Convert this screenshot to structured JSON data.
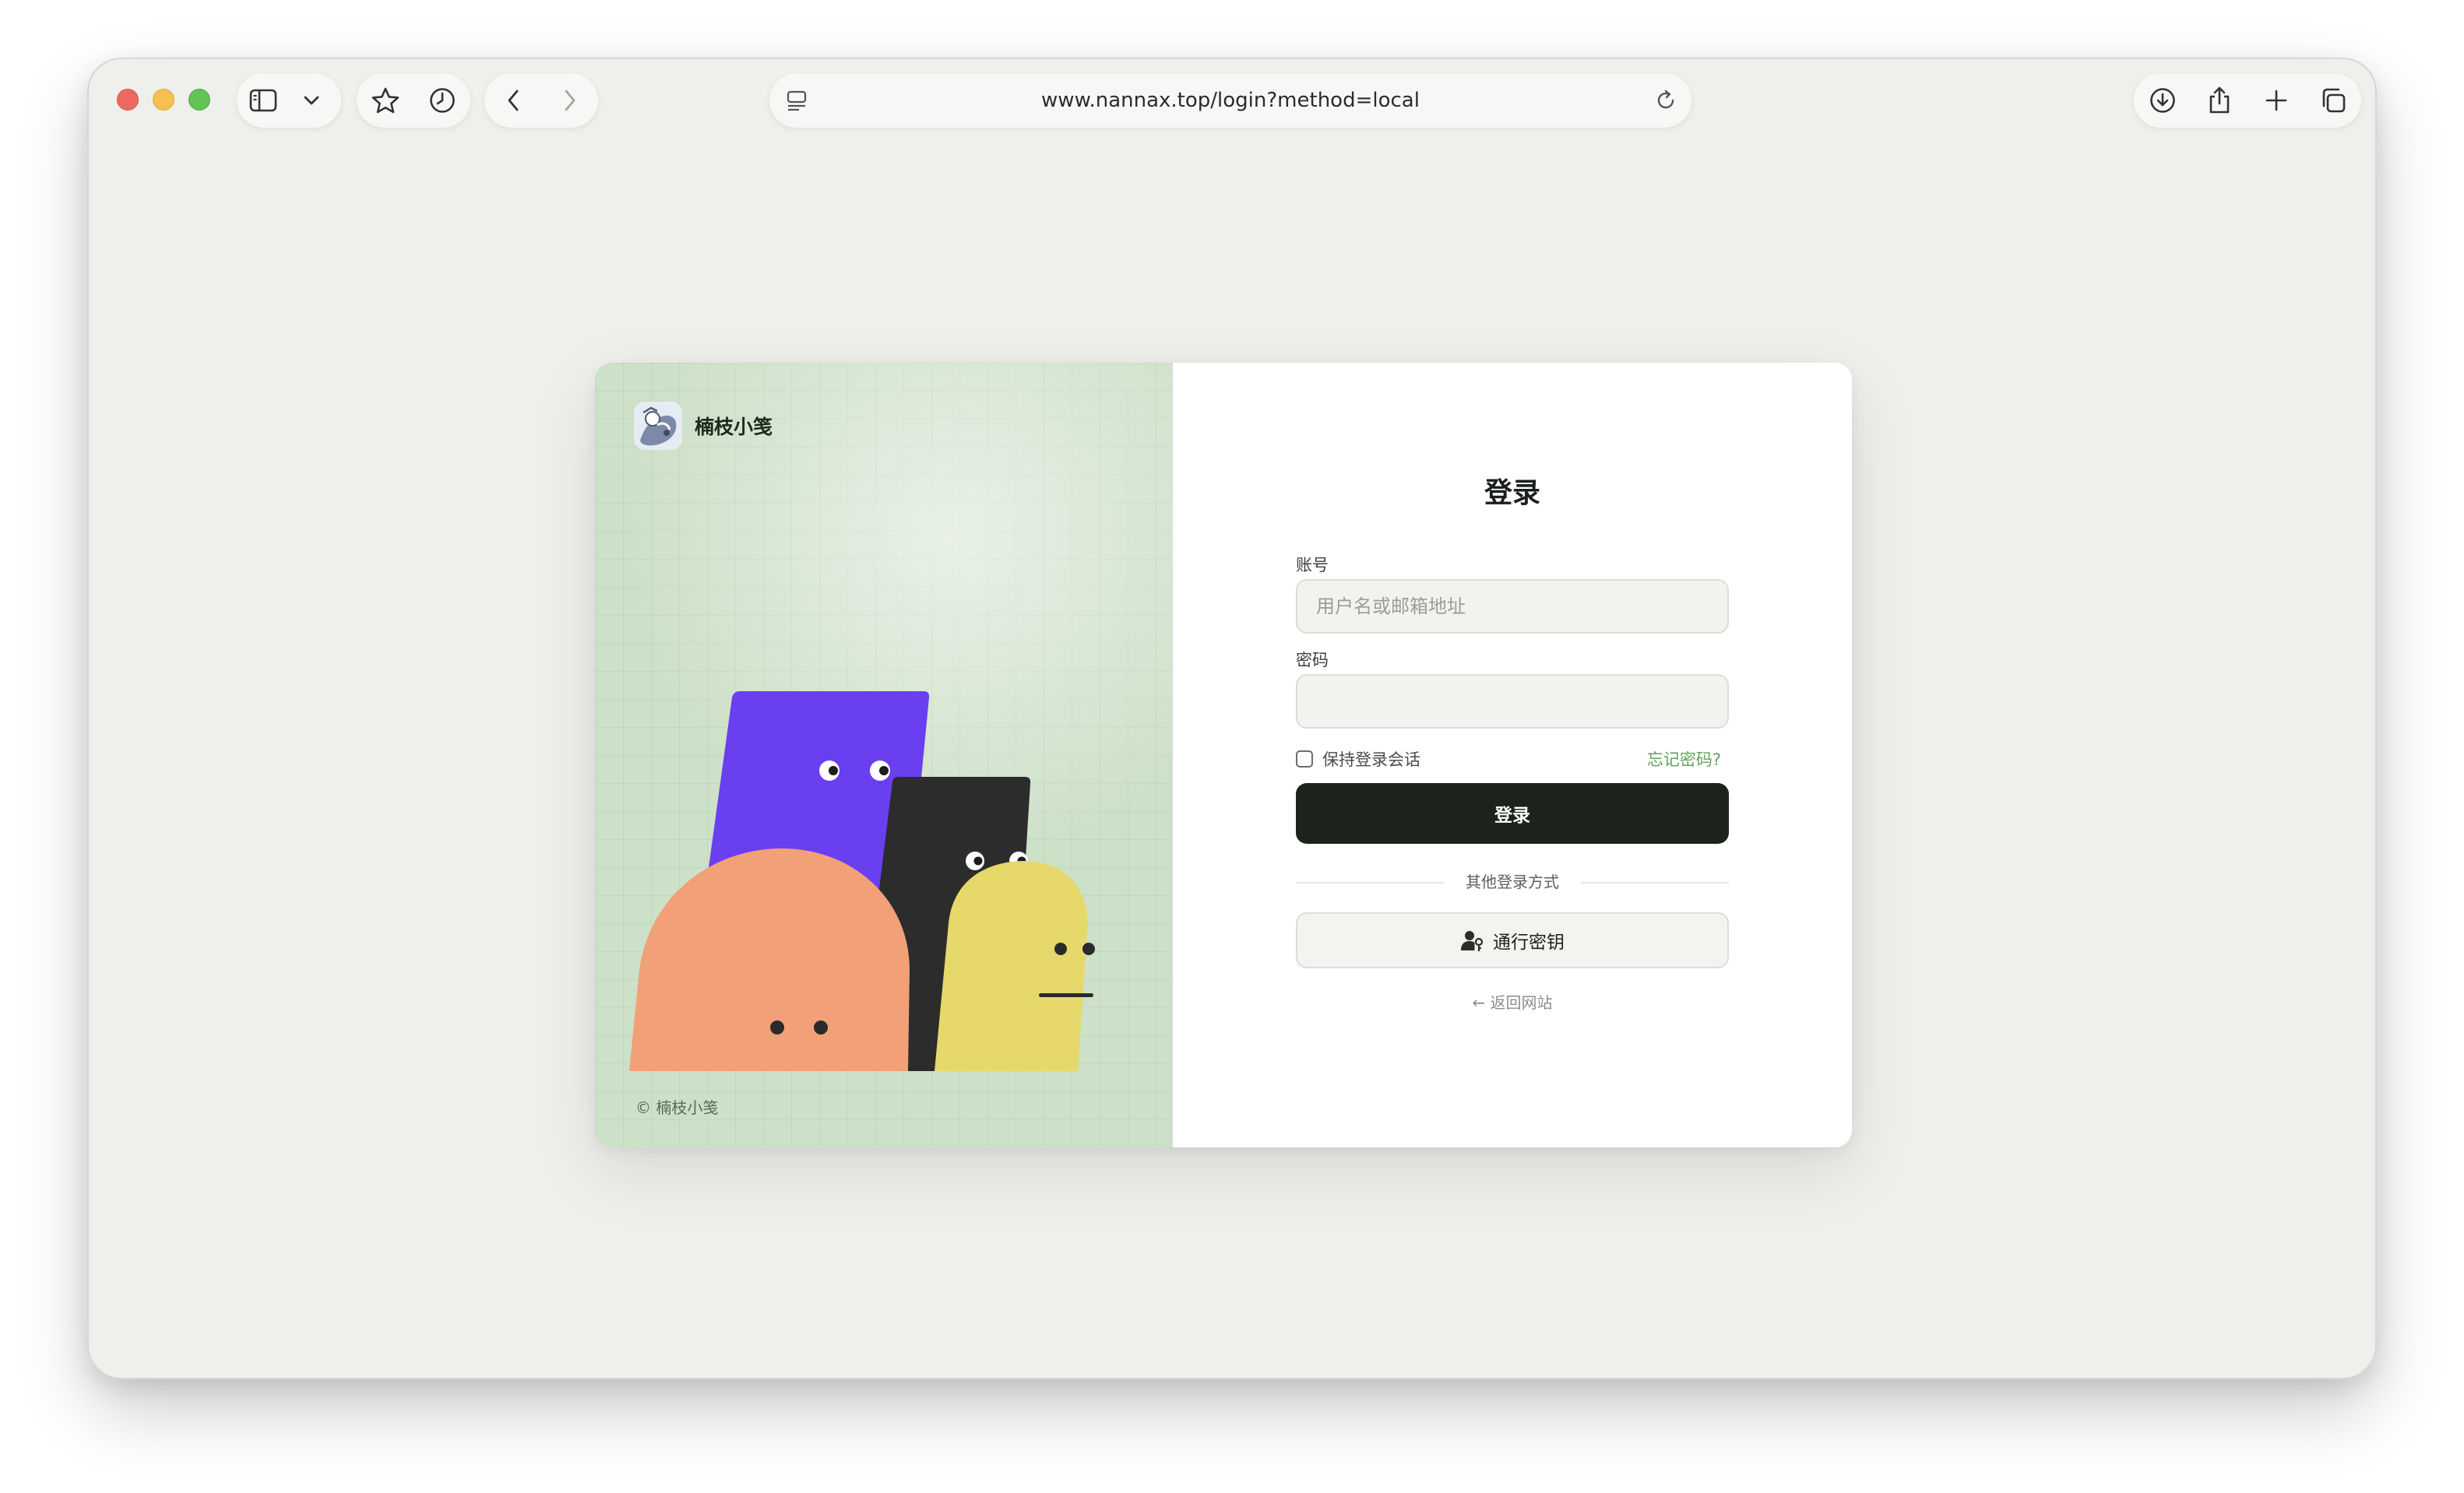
{
  "browser": {
    "url": "www.nannax.top/login?method=local",
    "icons": {
      "sidebar": "sidebar-icon",
      "chevron": "chevron-down-icon",
      "favorites": "star-icon",
      "history": "clock-icon",
      "back": "chevron-left-icon",
      "forward": "chevron-right-icon",
      "page": "page-menu-icon",
      "reload": "reload-icon",
      "downloads": "download-icon",
      "share": "share-icon",
      "new_tab": "plus-icon",
      "tab_overview": "tabs-icon"
    }
  },
  "brand": {
    "name": "楠枝小笺",
    "copyright": "© 楠枝小笺"
  },
  "login": {
    "title": "登录",
    "account_label": "账号",
    "account_placeholder": "用户名或邮箱地址",
    "account_value": "",
    "password_label": "密码",
    "password_value": "",
    "remember_label": "保持登录会话",
    "remember_checked": false,
    "forgot_label": "忘记密码?",
    "submit_label": "登录",
    "divider_label": "其他登录方式",
    "passkey_label": "通行密钥",
    "back_label": "← 返回网站"
  },
  "colors": {
    "accent_green": "#5fa35a",
    "primary_button": "#1c221c",
    "panel_bg": "#cde0c8",
    "character_purple": "#6a3ff0",
    "character_black": "#2c2c2c",
    "character_orange": "#f1a077",
    "character_yellow": "#e6d86b"
  }
}
